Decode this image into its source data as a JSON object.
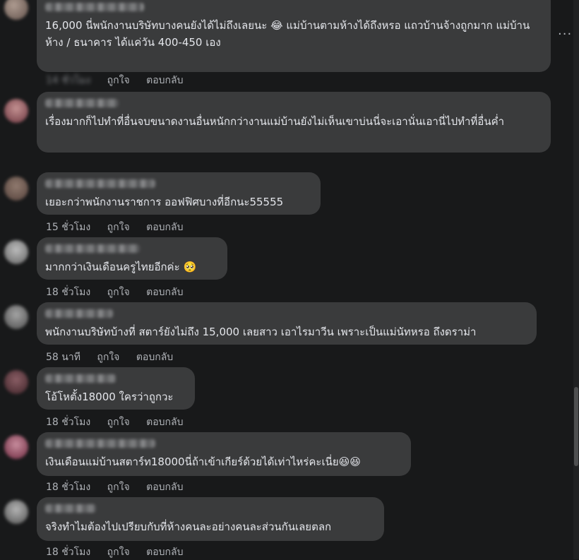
{
  "comments": [
    {
      "text": "16,000 นี่พนักงานบริษัทบางคนยังได้ไม่ถึงเลยนะ",
      "text2": "แม่บ้านตามห้างได้ถึงหรอ แถวบ้านจ้างถูกมาก แม่บ้านห้าง / ธนาคาร ได้แค่วัน 400-450 เอง",
      "emoji": "😂",
      "time": "14 ชั่วโมง",
      "like": "ถูกใจ",
      "reply": "ตอบกลับ"
    },
    {
      "text": "เรื่องมากก็ไปทำที่อื่นจบขนาดงานอื่นหนักกว่างานแม่บ้านยังไม่เห็นเขาบ่นนี่จะเอานั่นเอานี่ไปทำที่อื่นค่ำ",
      "time": "",
      "like": "",
      "reply": ""
    },
    {
      "text": "เยอะกว่าพนักงานราชการ ออฟฟิศบางที่อีกนะ55555",
      "time": "15 ชั่วโมง",
      "like": "ถูกใจ",
      "reply": "ตอบกลับ"
    },
    {
      "text": "มากกว่าเงินเดือนครูไทยอีกค่ะ",
      "emoji": "🥺",
      "time": "18 ชั่วโมง",
      "like": "ถูกใจ",
      "reply": "ตอบกลับ"
    },
    {
      "text": "พนักงานบริษัทบ้างที่ สตาร์ยังไม่ถึง 15,000 เลยสาว เอาไรมาวีน เพราะเป็นแม่นัทหรอ ถึงดราม่า",
      "time": "58 นาที",
      "like": "ถูกใจ",
      "reply": "ตอบกลับ"
    },
    {
      "text": "โอ้โหตั้ง18000 ใครว่าถูกวะ",
      "time": "18 ชั่วโมง",
      "like": "ถูกใจ",
      "reply": "ตอบกลับ"
    },
    {
      "text": "เงินเดือนแม่บ้านสตาร์ท18000นี่ถ้าเข้าเกียร์ด้วยได้เท่าไหร่คะเนี่ย",
      "emoji": "😆😆",
      "time": "18 ชั่วโมง",
      "like": "ถูกใจ",
      "reply": "ตอบกลับ"
    },
    {
      "text": "จริงทำไมต้องไปเปรียบกับที่ห้างคนละอย่างคนละส่วนกันเลยตลก",
      "time": "18 ชั่วโมง",
      "like": "ถูกใจ",
      "reply": "ตอบกลับ"
    }
  ],
  "more_label": "···",
  "colors": {
    "background": "#18191a",
    "bubble": "#3a3b3c",
    "text": "#e4e6eb",
    "muted": "#b0b3b8"
  }
}
